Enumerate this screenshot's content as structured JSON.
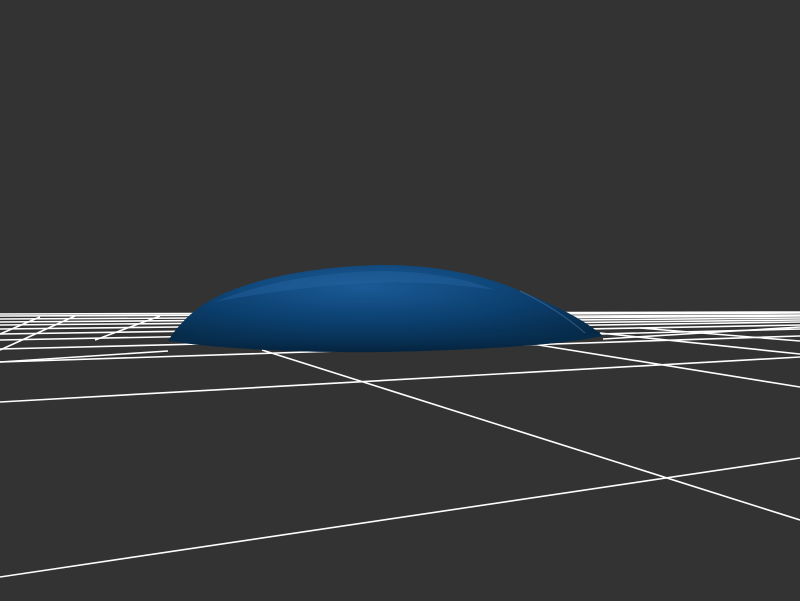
{
  "scene": {
    "background_color": "#333333",
    "grid_color": "#ffffff",
    "object": {
      "shape": "flattened-dome",
      "color_base": "#0b3f6e",
      "color_highlight": "#1a5a96",
      "color_shadow": "#062844"
    }
  }
}
